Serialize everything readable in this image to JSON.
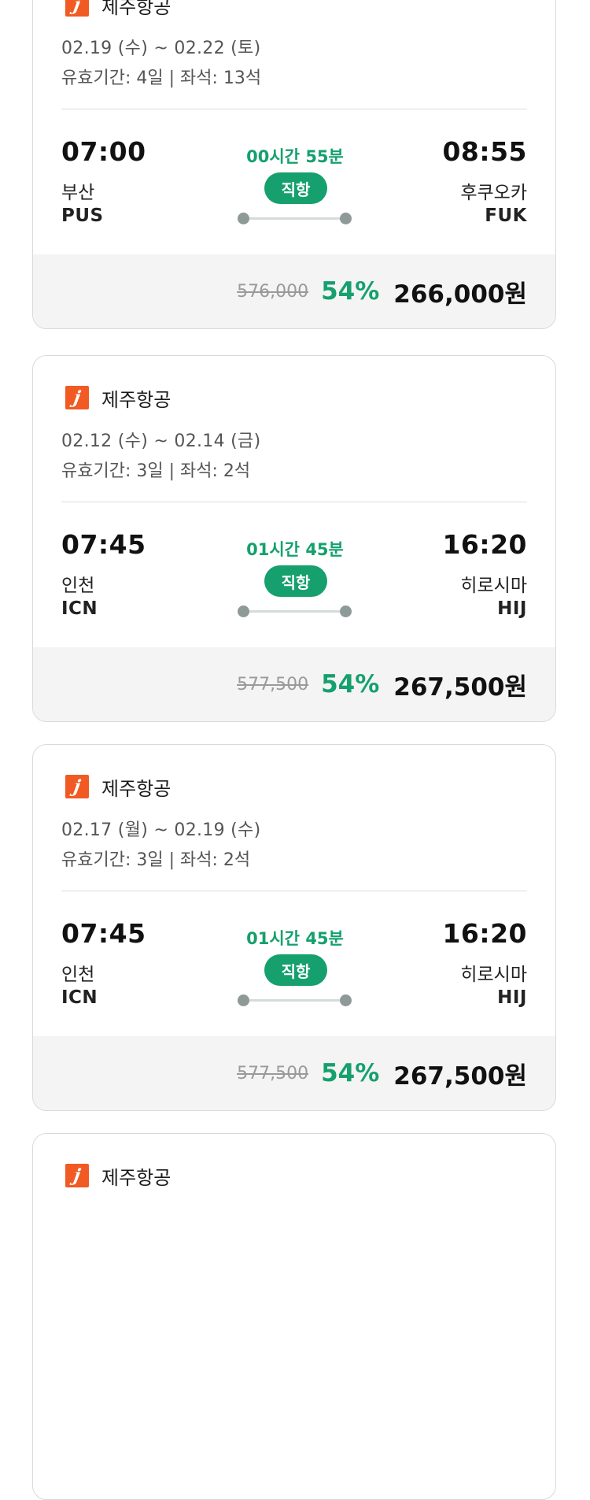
{
  "offers": [
    {
      "airline": "제주항공",
      "logo_letter": "j",
      "dates": "02.19 (수) ~ 02.22 (토)",
      "validity": "유효기간: 4일 | 좌석: 13석",
      "departure": {
        "time": "07:00",
        "city": "부산",
        "code": "PUS"
      },
      "arrival": {
        "time": "08:55",
        "city": "후쿠오카",
        "code": "FUK"
      },
      "duration": "00시간 55분",
      "flight_type": "직항",
      "original_price": "576,000",
      "discount": "54%",
      "price": "266,000원"
    },
    {
      "airline": "제주항공",
      "logo_letter": "j",
      "dates": "02.12 (수) ~ 02.14 (금)",
      "validity": "유효기간: 3일 | 좌석: 2석",
      "departure": {
        "time": "07:45",
        "city": "인천",
        "code": "ICN"
      },
      "arrival": {
        "time": "16:20",
        "city": "히로시마",
        "code": "HIJ"
      },
      "duration": "01시간 45분",
      "flight_type": "직항",
      "original_price": "577,500",
      "discount": "54%",
      "price": "267,500원"
    },
    {
      "airline": "제주항공",
      "logo_letter": "j",
      "dates": "02.17 (월) ~ 02.19 (수)",
      "validity": "유효기간: 3일 | 좌석: 2석",
      "departure": {
        "time": "07:45",
        "city": "인천",
        "code": "ICN"
      },
      "arrival": {
        "time": "16:20",
        "city": "히로시마",
        "code": "HIJ"
      },
      "duration": "01시간 45분",
      "flight_type": "직항",
      "original_price": "577,500",
      "discount": "54%",
      "price": "267,500원"
    },
    {
      "airline": "제주항공",
      "logo_letter": "j"
    }
  ],
  "colors": {
    "accent_green": "#15a06e",
    "brand_orange": "#f15a22",
    "price_bar_bg": "#f4f4f4"
  }
}
